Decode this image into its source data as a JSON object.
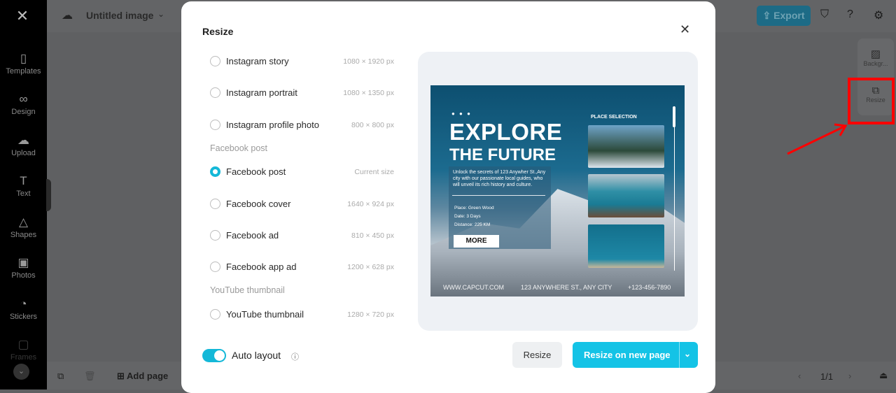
{
  "sidebar": {
    "items": [
      {
        "label": "Templates",
        "icon": "templates-icon"
      },
      {
        "label": "Design",
        "icon": "design-icon"
      },
      {
        "label": "Upload",
        "icon": "upload-icon"
      },
      {
        "label": "Text",
        "icon": "text-icon"
      },
      {
        "label": "Shapes",
        "icon": "shapes-icon"
      },
      {
        "label": "Photos",
        "icon": "photos-icon"
      },
      {
        "label": "Stickers",
        "icon": "stickers-icon"
      },
      {
        "label": "Frames",
        "icon": "frames-icon"
      }
    ]
  },
  "header": {
    "title": "Untitled image",
    "export_label": "Export"
  },
  "right_panel": {
    "background_label": "Backgr...",
    "resize_label": "Resize"
  },
  "bottom": {
    "add_page_label": "Add page",
    "page_indicator": "1/1"
  },
  "modal": {
    "title": "Resize",
    "options": [
      {
        "label": "Instagram story",
        "size": "1080 × 1920 px",
        "selected": false
      },
      {
        "label": "Instagram portrait",
        "size": "1080 × 1350 px",
        "selected": false
      },
      {
        "label": "Instagram profile photo",
        "size": "800 × 800 px",
        "selected": false
      },
      {
        "label": "Facebook post",
        "size": "Current size",
        "selected": true
      },
      {
        "label": "Facebook cover",
        "size": "1640 × 924 px",
        "selected": false
      },
      {
        "label": "Facebook ad",
        "size": "810 × 450 px",
        "selected": false
      },
      {
        "label": "Facebook app ad",
        "size": "1200 × 628 px",
        "selected": false
      },
      {
        "label": "YouTube thumbnail",
        "size": "1280 × 720 px",
        "selected": false
      }
    ],
    "groups": [
      "Facebook post",
      "YouTube thumbnail"
    ],
    "auto_layout_label": "Auto layout",
    "auto_layout_on": true,
    "resize_button": "Resize",
    "resize_new_page_button": "Resize on new page",
    "accent_color": "#14c3e6"
  },
  "poster": {
    "dots": "● ● ●",
    "heading1": "EXPLORE",
    "heading2": "THE FUTURE",
    "description": "Unlock the secrets of 123 Anywher St.,Any city with our passionate local guides, who will unveil its rich history and culture.",
    "place": "Place:   Green Wood",
    "date": "Date:    3 Days",
    "distance": "Distance:   225 KM",
    "more": "MORE",
    "place_selection": "PLACE SELECTION",
    "website": "WWW.CAPCUT.COM",
    "address": "123 ANYWHERE ST., ANY CITY",
    "phone": "+123-456-7890"
  }
}
